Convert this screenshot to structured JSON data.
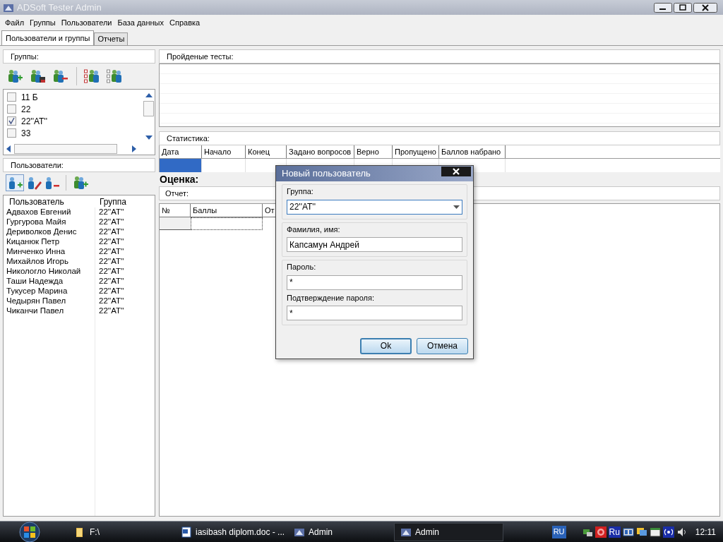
{
  "window": {
    "title": "ADSoft Tester Admin"
  },
  "menu": [
    "Файл",
    "Группы",
    "Пользователи",
    "База данных",
    "Справка"
  ],
  "tabs": [
    {
      "label": "Пользователи и группы",
      "selected": true
    },
    {
      "label": "Отчеты",
      "selected": false
    }
  ],
  "groups_panel": {
    "title": "Группы:"
  },
  "group_list": [
    {
      "label": "11 Б",
      "checked": false
    },
    {
      "label": "22",
      "checked": false
    },
    {
      "label": "22''AT''",
      "checked": true
    },
    {
      "label": "33",
      "checked": false
    }
  ],
  "users_panel": {
    "title": "Пользователи:"
  },
  "users_table": {
    "columns": [
      "Пользователь",
      "Группа"
    ],
    "rows": [
      [
        "Адвахов Евгений",
        "22''AT''"
      ],
      [
        "Гургурова Майя",
        "22''AT''"
      ],
      [
        "Дериволков Денис",
        "22''AT''"
      ],
      [
        "Кицанюк Петр",
        "22''AT''"
      ],
      [
        "Минченко Инна",
        "22''AT''"
      ],
      [
        "Михайлов Игорь",
        "22''AT''"
      ],
      [
        "Никологло Николай",
        "22''AT''"
      ],
      [
        "Таши Надежда",
        "22''AT''"
      ],
      [
        "Тукусер Марина",
        "22''AT''"
      ],
      [
        "Чедырян Павел",
        "22''AT''"
      ],
      [
        "Чиканчи Павел",
        "22''AT''"
      ]
    ]
  },
  "passed_tests": {
    "title": "Пройденые тесты:"
  },
  "statistics": {
    "title": "Статистика:",
    "columns": [
      "Дата",
      "Начало",
      "Конец",
      "Задано вопросов",
      "Верно",
      "Пропущено",
      "Баллов набрано"
    ],
    "rows": [
      {
        "selected": true
      }
    ]
  },
  "grade": {
    "label": "Оценка:"
  },
  "report": {
    "title": "Отчет:",
    "columns": [
      "№",
      "Баллы",
      "От"
    ]
  },
  "dialog": {
    "title": "Новый пользователь",
    "fields": [
      {
        "kind": "combo",
        "label": "Группа:",
        "value": "22''AT''"
      },
      {
        "kind": "text",
        "label": "Фамилия, имя:",
        "value": "Капсамун Андрей"
      },
      {
        "kind": "password",
        "label": "Пароль:",
        "value": "*"
      },
      {
        "kind": "password",
        "label": "Подтверждение пароля:",
        "value": "*"
      }
    ],
    "buttons": [
      {
        "label": "Ok",
        "default": true
      },
      {
        "label": "Отмена",
        "default": false
      }
    ]
  },
  "taskbar": {
    "tasks": [
      {
        "label": "F:\\",
        "kind": "folder",
        "active": false
      },
      {
        "label": "iasibash diplom.doc - ...",
        "kind": "document",
        "active": false
      },
      {
        "label": "Admin",
        "kind": "app",
        "active": false
      },
      {
        "label": "Admin",
        "kind": "app",
        "active": true
      }
    ],
    "language": "RU",
    "tray_language": "Ru",
    "clock": "12:11"
  }
}
